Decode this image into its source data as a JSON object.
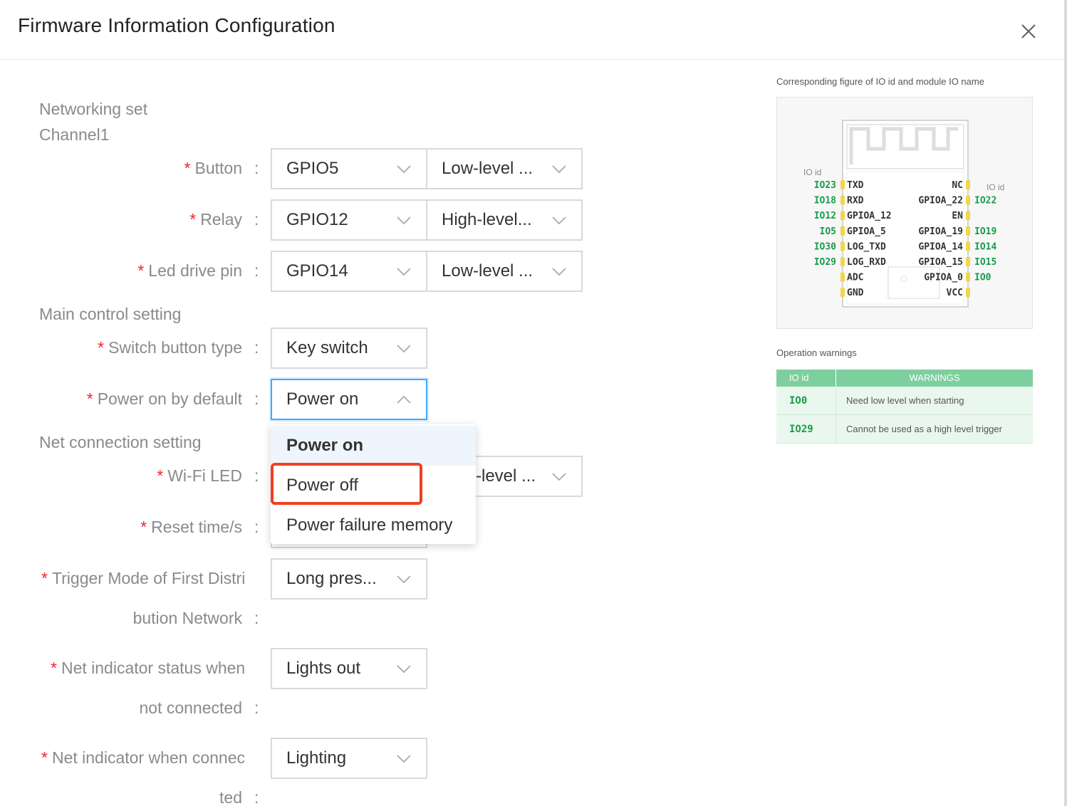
{
  "modal": {
    "title": "Firmware Information Configuration"
  },
  "sections": {
    "networking": "Networking set",
    "channel": "Channel1",
    "main_control": "Main control setting",
    "net_connection": "Net connection setting"
  },
  "fields": {
    "button": {
      "label": "Button",
      "pin": "GPIO5",
      "level": "Low-level ..."
    },
    "relay": {
      "label": "Relay",
      "pin": "GPIO12",
      "level": "High-level..."
    },
    "led_drive": {
      "label": "Led drive pin",
      "pin": "GPIO14",
      "level": "Low-level ..."
    },
    "switch_type": {
      "label": "Switch button type",
      "value": "Key switch"
    },
    "power_default": {
      "label": "Power on by default",
      "value": "Power on"
    },
    "wifi_led": {
      "label": "Wi-Fi LED",
      "level": "-level ..."
    },
    "reset_time": {
      "label": "Reset time/s"
    },
    "trigger_mode": {
      "label_line1": "Trigger Mode of First Distri",
      "label_line2": "bution Network",
      "value": "Long pres..."
    },
    "net_indicator_nc": {
      "label_line1": "Net indicator status when",
      "label_line2": "not connected",
      "value": "Lights out"
    },
    "net_indicator_c": {
      "label_line1": "Net indicator when connec",
      "label_line2": "ted",
      "value": "Lighting"
    }
  },
  "colon": ":",
  "dropdown": {
    "options": [
      "Power on",
      "Power off",
      "Power failure memory"
    ],
    "selected_index": 0,
    "highlighted_index": 1
  },
  "figure": {
    "caption": "Corresponding figure of IO id and module IO name",
    "io_id_label": "IO id",
    "left_pins": [
      {
        "io": "IO23",
        "name": "TXD"
      },
      {
        "io": "IO18",
        "name": "RXD"
      },
      {
        "io": "IO12",
        "name": "GPIOA_12"
      },
      {
        "io": "IO5",
        "name": "GPIOA_5"
      },
      {
        "io": "IO30",
        "name": "LOG_TXD"
      },
      {
        "io": "IO29",
        "name": "LOG_RXD"
      },
      {
        "io": "",
        "name": "ADC"
      },
      {
        "io": "",
        "name": "GND"
      }
    ],
    "right_pins": [
      {
        "io": "",
        "name": "NC"
      },
      {
        "io": "IO22",
        "name": "GPIOA_22"
      },
      {
        "io": "",
        "name": "EN"
      },
      {
        "io": "IO19",
        "name": "GPIOA_19"
      },
      {
        "io": "IO14",
        "name": "GPIOA_14"
      },
      {
        "io": "IO15",
        "name": "GPIOA_15"
      },
      {
        "io": "IO0",
        "name": "GPIOA_0"
      },
      {
        "io": "",
        "name": "VCC"
      }
    ]
  },
  "warnings": {
    "caption": "Operation warnings",
    "headers": [
      "IO id",
      "WARNINGS"
    ],
    "rows": [
      {
        "io": "IO0",
        "text": "Need low level when starting"
      },
      {
        "io": "IO29",
        "text": "Cannot be used as a high level trigger"
      }
    ]
  },
  "colors": {
    "required": "#f5222d",
    "focus": "#40a9ff",
    "highlight": "#f0401f",
    "pin_green": "#1a9b4b",
    "table_header": "#7ecf9e"
  }
}
